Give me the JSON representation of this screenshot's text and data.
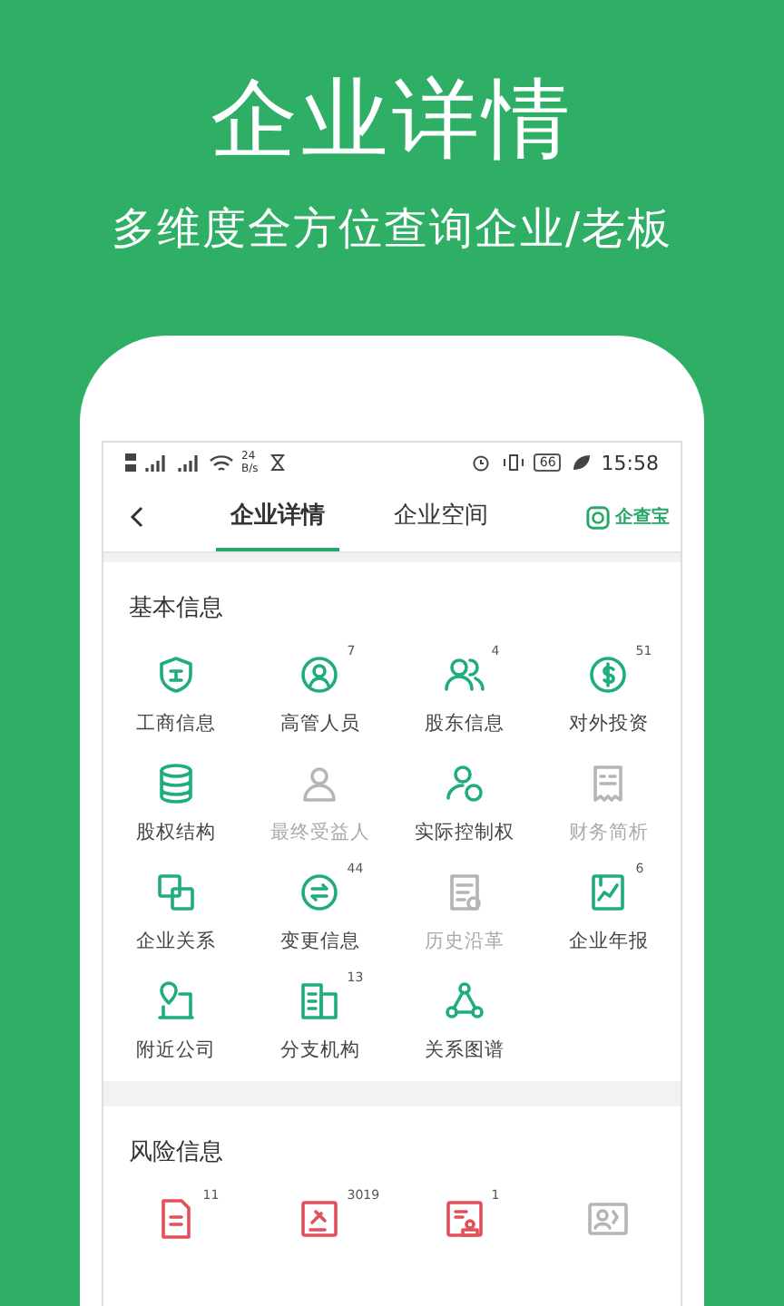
{
  "promo": {
    "title": "企业详情",
    "subtitle": "多维度全方位查询企业/老板"
  },
  "status_bar": {
    "net_speed": "24",
    "net_unit": "B/s",
    "battery": "66",
    "time": "15:58"
  },
  "nav": {
    "tabs": [
      {
        "label": "企业详情",
        "selected": true
      },
      {
        "label": "企业空间",
        "selected": false
      }
    ],
    "brand": "企查宝"
  },
  "sections": [
    {
      "title": "基本信息",
      "kind": "basic",
      "items": [
        {
          "label": "工商信息",
          "disabled": false
        },
        {
          "label": "高管人员",
          "badge": "7",
          "disabled": false
        },
        {
          "label": "股东信息",
          "badge": "4",
          "disabled": false
        },
        {
          "label": "对外投资",
          "badge": "51",
          "disabled": false
        },
        {
          "label": "股权结构",
          "disabled": false
        },
        {
          "label": "最终受益人",
          "disabled": true
        },
        {
          "label": "实际控制权",
          "disabled": false
        },
        {
          "label": "财务简析",
          "disabled": true
        },
        {
          "label": "企业关系",
          "disabled": false
        },
        {
          "label": "变更信息",
          "badge": "44",
          "disabled": false
        },
        {
          "label": "历史沿革",
          "disabled": true
        },
        {
          "label": "企业年报",
          "badge": "6",
          "disabled": false
        },
        {
          "label": "附近公司",
          "disabled": false
        },
        {
          "label": "分支机构",
          "badge": "13",
          "disabled": false
        },
        {
          "label": "关系图谱",
          "disabled": false
        }
      ]
    },
    {
      "title": "风险信息",
      "kind": "risk",
      "items": [
        {
          "badge": "11",
          "disabled": false
        },
        {
          "badge": "3019",
          "disabled": false
        },
        {
          "badge": "1",
          "disabled": false
        },
        {
          "disabled": true
        }
      ]
    }
  ]
}
